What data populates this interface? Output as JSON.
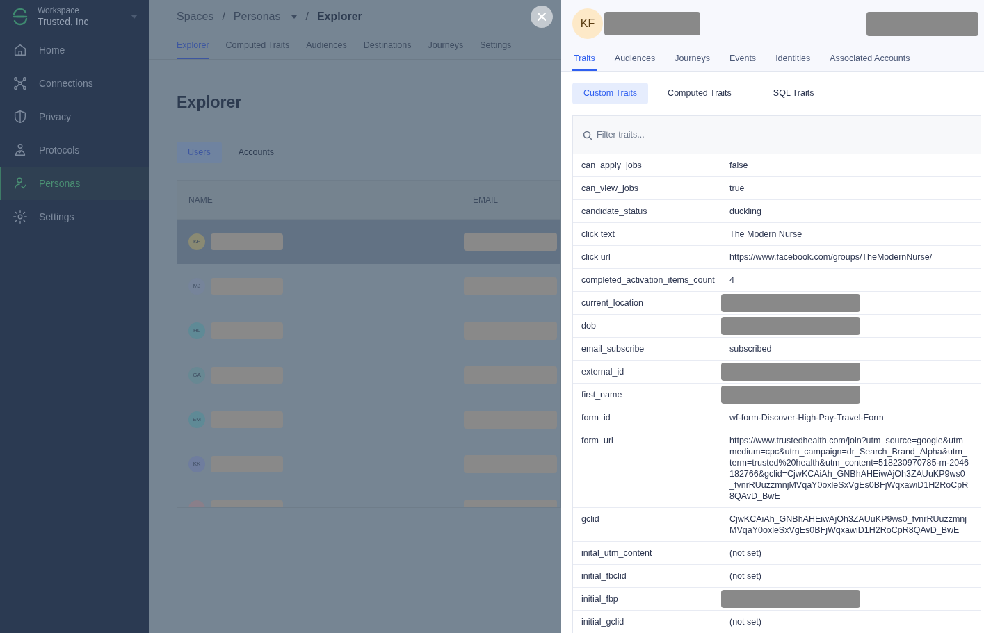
{
  "sidebar": {
    "workspace_label": "Workspace",
    "workspace_name": "Trusted, Inc",
    "items": [
      {
        "label": "Home",
        "kind": "home",
        "selected": false
      },
      {
        "label": "Connections",
        "kind": "connections",
        "selected": false
      },
      {
        "label": "Privacy",
        "kind": "privacy",
        "selected": false
      },
      {
        "label": "Protocols",
        "kind": "protocols",
        "selected": false
      },
      {
        "label": "Personas",
        "kind": "personas",
        "selected": true
      },
      {
        "label": "Settings",
        "kind": "settings",
        "selected": false
      }
    ]
  },
  "breadcrumb": [
    {
      "label": "Spaces",
      "dropdown": false,
      "current": false
    },
    {
      "separator": "/",
      "label": "Personas",
      "dropdown": true,
      "current": false
    },
    {
      "separator": "/",
      "label": "Explorer",
      "dropdown": false,
      "current": true
    }
  ],
  "page_tabs": [
    {
      "label": "Explorer",
      "selected": true
    },
    {
      "label": "Computed Traits",
      "selected": false
    },
    {
      "label": "Audiences",
      "selected": false
    },
    {
      "label": "Destinations",
      "selected": false
    },
    {
      "label": "Journeys",
      "selected": false
    },
    {
      "label": "Settings",
      "selected": false
    }
  ],
  "page_title": "Explorer",
  "explorer_tabs": [
    {
      "label": "Users",
      "selected": true
    },
    {
      "label": "Accounts",
      "selected": false
    }
  ],
  "users_table": {
    "columns": [
      "NAME",
      "EMAIL"
    ],
    "rows": [
      {
        "initials": "KF",
        "color": "#8a8a73",
        "selected": true
      },
      {
        "initials": "MJ",
        "color": "#76849a",
        "selected": false
      },
      {
        "initials": "HL",
        "color": "#5f8a96",
        "selected": false
      },
      {
        "initials": "GA",
        "color": "#688893",
        "selected": false
      },
      {
        "initials": "EM",
        "color": "#5f8a96",
        "selected": false
      },
      {
        "initials": "KK",
        "color": "#6f7d9e",
        "selected": false
      },
      {
        "color": "#8a7f8a",
        "selected": false
      }
    ]
  },
  "profile": {
    "initials": "KF",
    "tabs": [
      {
        "label": "Traits",
        "selected": true
      },
      {
        "label": "Audiences",
        "selected": false
      },
      {
        "label": "Journeys",
        "selected": false
      },
      {
        "label": "Events",
        "selected": false
      },
      {
        "label": "Identities",
        "selected": false
      },
      {
        "label": "Associated Accounts",
        "selected": false
      }
    ],
    "trait_tabs": [
      {
        "label": "Custom Traits",
        "selected": true
      },
      {
        "label": "Computed Traits",
        "selected": false
      },
      {
        "label": "SQL Traits",
        "selected": false
      }
    ],
    "filter": {
      "placeholder": "Filter traits..."
    },
    "traits": [
      {
        "name": "can_apply_jobs",
        "value": "false",
        "redacted": false
      },
      {
        "name": "can_view_jobs",
        "value": "true",
        "redacted": false
      },
      {
        "name": "candidate_status",
        "value": "duckling",
        "redacted": false
      },
      {
        "name": "click text",
        "value": "The Modern Nurse",
        "redacted": false
      },
      {
        "name": "click url",
        "value": "https://www.facebook.com/groups/TheModernNurse/",
        "redacted": false
      },
      {
        "name": "completed_activation_items_count",
        "value": "4",
        "redacted": false
      },
      {
        "name": "current_location",
        "redacted": true
      },
      {
        "name": "dob",
        "redacted": true
      },
      {
        "name": "email_subscribe",
        "value": "subscribed",
        "redacted": false
      },
      {
        "name": "external_id",
        "redacted": true
      },
      {
        "name": "first_name",
        "redacted": true
      },
      {
        "name": "form_id",
        "value": "wf-form-Discover-High-Pay-Travel-Form",
        "redacted": false
      },
      {
        "name": "form_url",
        "value": "https://www.trustedhealth.com/join?utm_source=google&utm_medium=cpc&utm_campaign=dr_Search_Brand_Alpha&utm_term=trusted%20health&utm_content=518230970785-m-2046182766&gclid=CjwKCAiAh_GNBhAHEiwAjOh3ZAUuKP9ws0_fvnrRUuzzmnjMVqaY0oxleSxVgEs0BFjWqxawiD1H2RoCpR8QAvD_BwE",
        "redacted": false
      },
      {
        "name": "gclid",
        "value": "CjwKCAiAh_GNBhAHEiwAjOh3ZAUuKP9ws0_fvnrRUuzzmnjMVqaY0oxleSxVgEs0BFjWqxawiD1H2RoCpR8QAvD_BwE",
        "redacted": false
      },
      {
        "name": "inital_utm_content",
        "value": "(not set)",
        "redacted": false
      },
      {
        "name": "initial_fbclid",
        "value": "(not set)",
        "redacted": false
      },
      {
        "name": "initial_fbp",
        "redacted": true
      },
      {
        "name": "initial_gclid",
        "value": "(not set)",
        "redacted": false
      }
    ]
  }
}
